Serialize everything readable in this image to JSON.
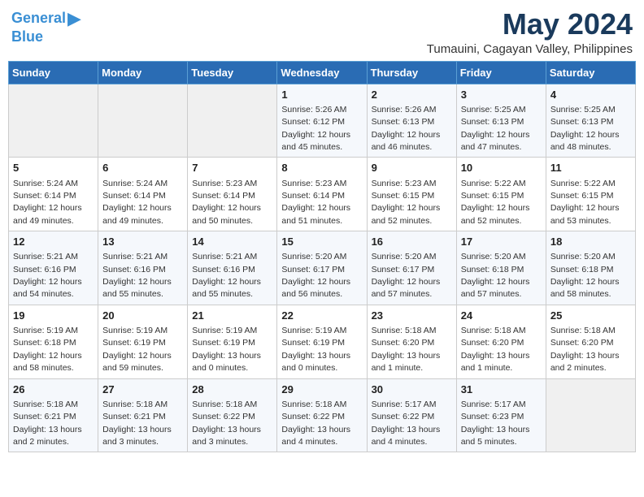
{
  "logo": {
    "line1": "General",
    "line2": "Blue",
    "arrow": "▶"
  },
  "title": "May 2024",
  "subtitle": "Tumauini, Cagayan Valley, Philippines",
  "days_of_week": [
    "Sunday",
    "Monday",
    "Tuesday",
    "Wednesday",
    "Thursday",
    "Friday",
    "Saturday"
  ],
  "weeks": [
    [
      {
        "day": "",
        "info": ""
      },
      {
        "day": "",
        "info": ""
      },
      {
        "day": "",
        "info": ""
      },
      {
        "day": "1",
        "info": "Sunrise: 5:26 AM\nSunset: 6:12 PM\nDaylight: 12 hours\nand 45 minutes."
      },
      {
        "day": "2",
        "info": "Sunrise: 5:26 AM\nSunset: 6:13 PM\nDaylight: 12 hours\nand 46 minutes."
      },
      {
        "day": "3",
        "info": "Sunrise: 5:25 AM\nSunset: 6:13 PM\nDaylight: 12 hours\nand 47 minutes."
      },
      {
        "day": "4",
        "info": "Sunrise: 5:25 AM\nSunset: 6:13 PM\nDaylight: 12 hours\nand 48 minutes."
      }
    ],
    [
      {
        "day": "5",
        "info": "Sunrise: 5:24 AM\nSunset: 6:14 PM\nDaylight: 12 hours\nand 49 minutes."
      },
      {
        "day": "6",
        "info": "Sunrise: 5:24 AM\nSunset: 6:14 PM\nDaylight: 12 hours\nand 49 minutes."
      },
      {
        "day": "7",
        "info": "Sunrise: 5:23 AM\nSunset: 6:14 PM\nDaylight: 12 hours\nand 50 minutes."
      },
      {
        "day": "8",
        "info": "Sunrise: 5:23 AM\nSunset: 6:14 PM\nDaylight: 12 hours\nand 51 minutes."
      },
      {
        "day": "9",
        "info": "Sunrise: 5:23 AM\nSunset: 6:15 PM\nDaylight: 12 hours\nand 52 minutes."
      },
      {
        "day": "10",
        "info": "Sunrise: 5:22 AM\nSunset: 6:15 PM\nDaylight: 12 hours\nand 52 minutes."
      },
      {
        "day": "11",
        "info": "Sunrise: 5:22 AM\nSunset: 6:15 PM\nDaylight: 12 hours\nand 53 minutes."
      }
    ],
    [
      {
        "day": "12",
        "info": "Sunrise: 5:21 AM\nSunset: 6:16 PM\nDaylight: 12 hours\nand 54 minutes."
      },
      {
        "day": "13",
        "info": "Sunrise: 5:21 AM\nSunset: 6:16 PM\nDaylight: 12 hours\nand 55 minutes."
      },
      {
        "day": "14",
        "info": "Sunrise: 5:21 AM\nSunset: 6:16 PM\nDaylight: 12 hours\nand 55 minutes."
      },
      {
        "day": "15",
        "info": "Sunrise: 5:20 AM\nSunset: 6:17 PM\nDaylight: 12 hours\nand 56 minutes."
      },
      {
        "day": "16",
        "info": "Sunrise: 5:20 AM\nSunset: 6:17 PM\nDaylight: 12 hours\nand 57 minutes."
      },
      {
        "day": "17",
        "info": "Sunrise: 5:20 AM\nSunset: 6:18 PM\nDaylight: 12 hours\nand 57 minutes."
      },
      {
        "day": "18",
        "info": "Sunrise: 5:20 AM\nSunset: 6:18 PM\nDaylight: 12 hours\nand 58 minutes."
      }
    ],
    [
      {
        "day": "19",
        "info": "Sunrise: 5:19 AM\nSunset: 6:18 PM\nDaylight: 12 hours\nand 58 minutes."
      },
      {
        "day": "20",
        "info": "Sunrise: 5:19 AM\nSunset: 6:19 PM\nDaylight: 12 hours\nand 59 minutes."
      },
      {
        "day": "21",
        "info": "Sunrise: 5:19 AM\nSunset: 6:19 PM\nDaylight: 13 hours\nand 0 minutes."
      },
      {
        "day": "22",
        "info": "Sunrise: 5:19 AM\nSunset: 6:19 PM\nDaylight: 13 hours\nand 0 minutes."
      },
      {
        "day": "23",
        "info": "Sunrise: 5:18 AM\nSunset: 6:20 PM\nDaylight: 13 hours\nand 1 minute."
      },
      {
        "day": "24",
        "info": "Sunrise: 5:18 AM\nSunset: 6:20 PM\nDaylight: 13 hours\nand 1 minute."
      },
      {
        "day": "25",
        "info": "Sunrise: 5:18 AM\nSunset: 6:20 PM\nDaylight: 13 hours\nand 2 minutes."
      }
    ],
    [
      {
        "day": "26",
        "info": "Sunrise: 5:18 AM\nSunset: 6:21 PM\nDaylight: 13 hours\nand 2 minutes."
      },
      {
        "day": "27",
        "info": "Sunrise: 5:18 AM\nSunset: 6:21 PM\nDaylight: 13 hours\nand 3 minutes."
      },
      {
        "day": "28",
        "info": "Sunrise: 5:18 AM\nSunset: 6:22 PM\nDaylight: 13 hours\nand 3 minutes."
      },
      {
        "day": "29",
        "info": "Sunrise: 5:18 AM\nSunset: 6:22 PM\nDaylight: 13 hours\nand 4 minutes."
      },
      {
        "day": "30",
        "info": "Sunrise: 5:17 AM\nSunset: 6:22 PM\nDaylight: 13 hours\nand 4 minutes."
      },
      {
        "day": "31",
        "info": "Sunrise: 5:17 AM\nSunset: 6:23 PM\nDaylight: 13 hours\nand 5 minutes."
      },
      {
        "day": "",
        "info": ""
      }
    ]
  ]
}
